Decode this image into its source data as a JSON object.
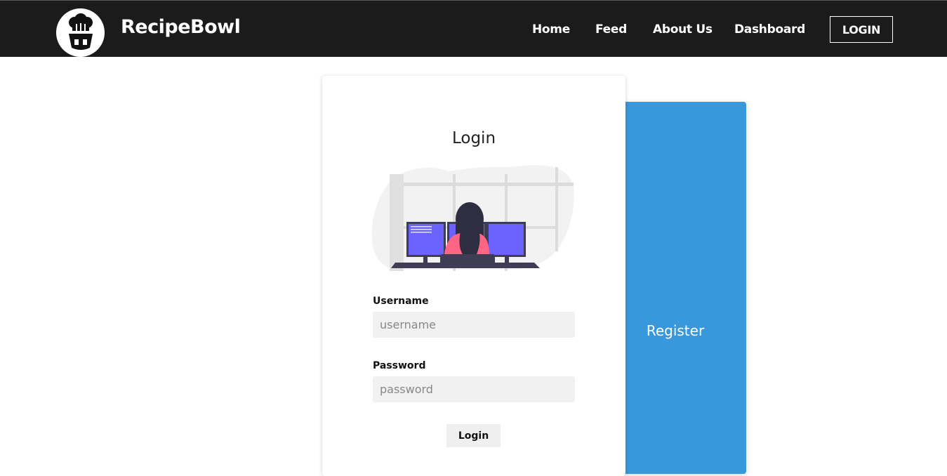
{
  "brand": {
    "name": "RecipeBowl",
    "logo_icon": "chef-hat-utensils-icon"
  },
  "nav": {
    "items": [
      {
        "label": "Home"
      },
      {
        "label": "Feed"
      },
      {
        "label": "About Us"
      },
      {
        "label": "Dashboard"
      }
    ],
    "login_label": "LOGIN"
  },
  "login_card": {
    "title": "Login",
    "illustration_icon": "woman-at-computers-illustration",
    "username": {
      "label": "Username",
      "placeholder": "username",
      "value": ""
    },
    "password": {
      "label": "Password",
      "placeholder": "password",
      "value": ""
    },
    "submit_label": "Login"
  },
  "register_panel": {
    "label": "Register"
  },
  "colors": {
    "navbar_bg": "#1c1b1b",
    "accent_blue": "#3898db",
    "input_bg": "#f1f1f1",
    "monitor_screen": "#6c63ff",
    "shirt": "#ff6584"
  }
}
